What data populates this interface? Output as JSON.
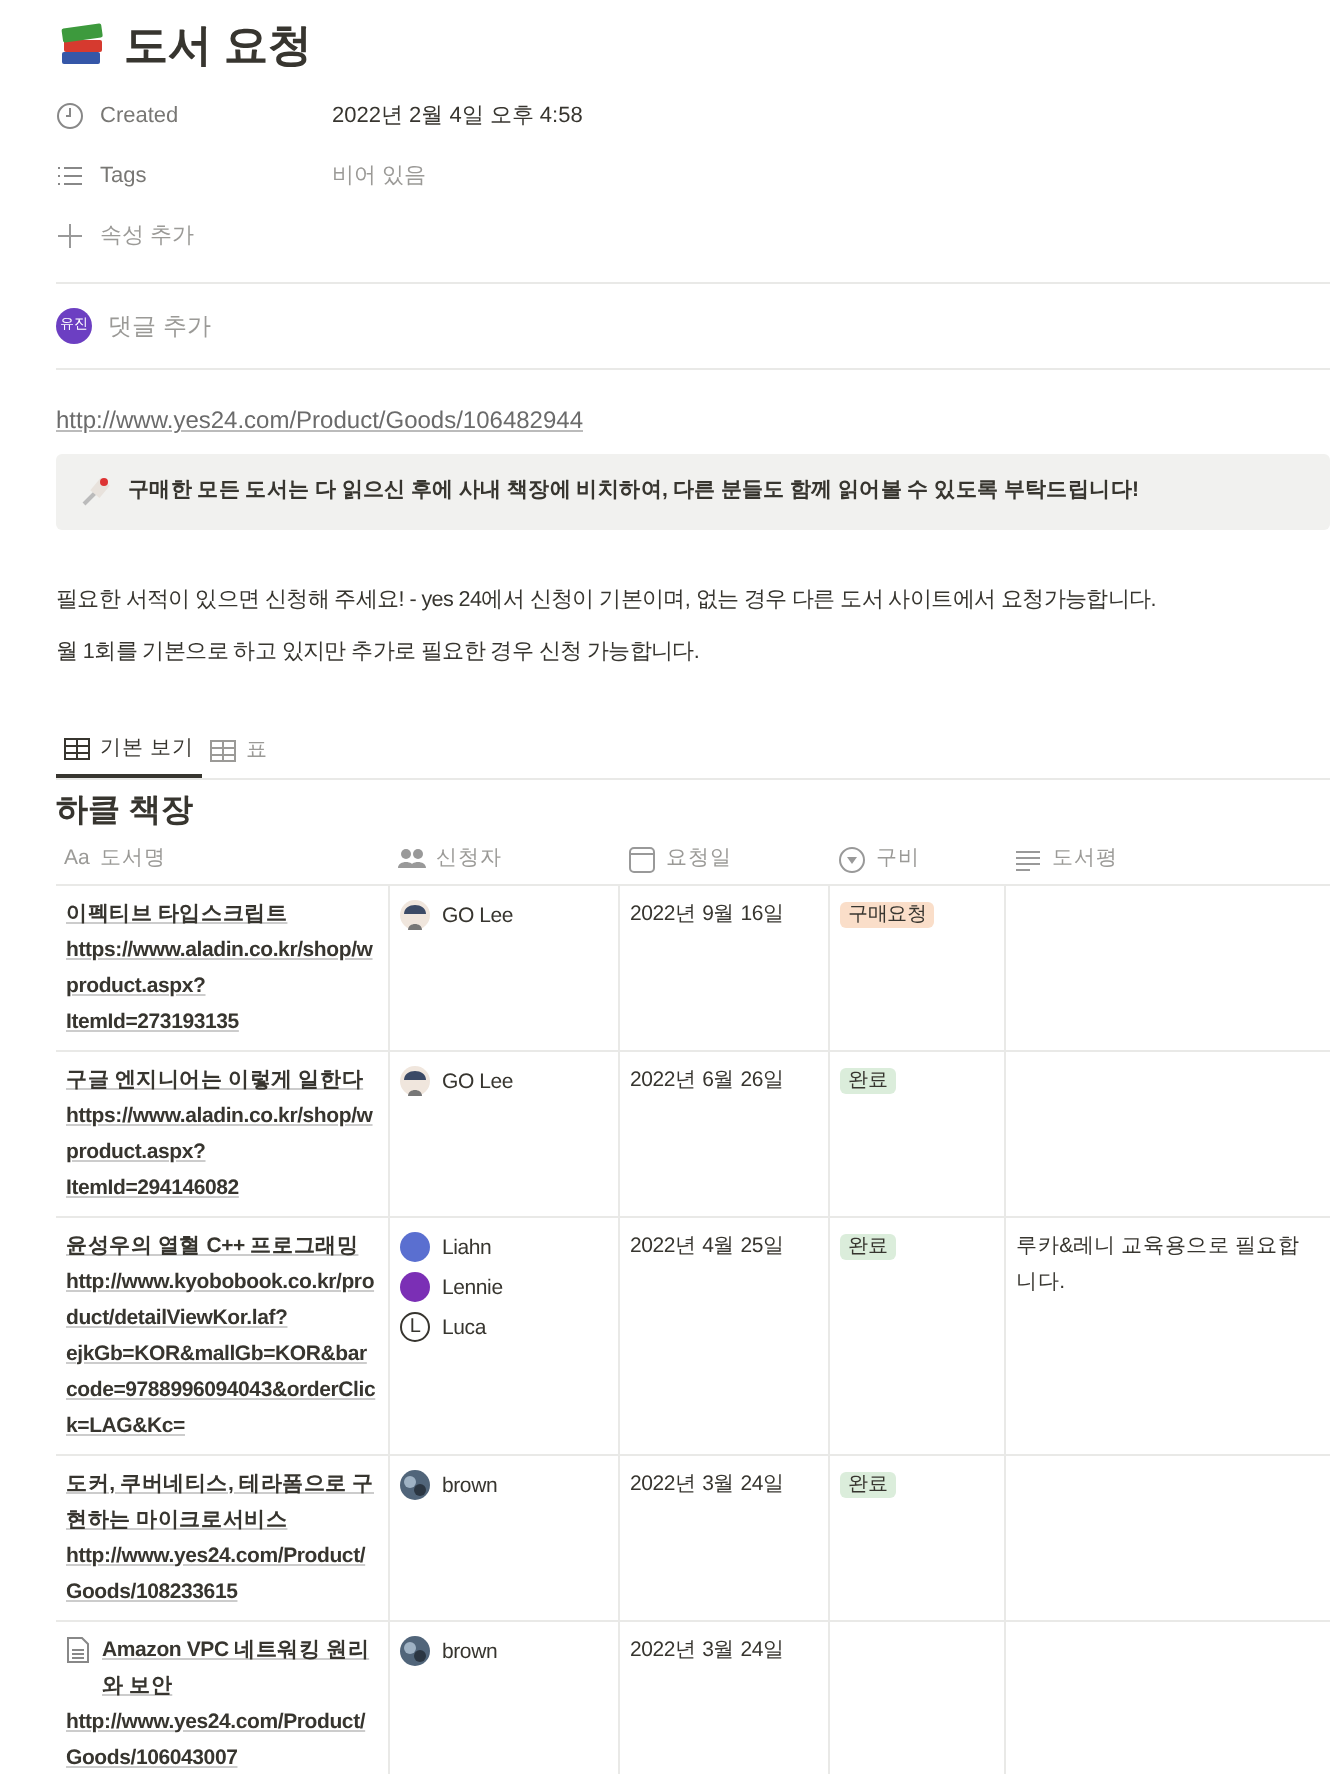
{
  "page": {
    "title": "도서 요청"
  },
  "properties": [
    {
      "kind": "date",
      "label": "Created",
      "value": "2022년 2월 4일 오후 4:58"
    },
    {
      "kind": "tags",
      "label": "Tags",
      "placeholder": "비어 있음"
    }
  ],
  "add_property": "속성 추가",
  "comment": {
    "avatar": "유진",
    "placeholder": "댓글 추가"
  },
  "link": "http://www.yes24.com/Product/Goods/106482944",
  "callout": "구매한 모든 도서는 다 읽으신 후에 사내 책장에 비치하여, 다른 분들도 함께 읽어볼 수 있도록 부탁드립니다!",
  "paragraphs": [
    "필요한 서적이 있으면 신청해 주세요! - yes 24에서 신청이 기본이며, 없는 경우 다른 도서 사이트에서 요청가능합니다.",
    "월 1회를 기본으로 하고 있지만 추가로 필요한 경우 신청 가능합니다."
  ],
  "views": [
    {
      "label": "기본 보기",
      "selected": true
    },
    {
      "label": "표",
      "selected": false
    }
  ],
  "database": {
    "title": "하클 책장",
    "columns": [
      {
        "kind": "title",
        "icon_text": "Aa",
        "label": "도서명"
      },
      {
        "kind": "person",
        "label": "신청자"
      },
      {
        "kind": "date",
        "label": "요청일"
      },
      {
        "kind": "select",
        "label": "구비"
      },
      {
        "kind": "text",
        "label": "도서평"
      }
    ],
    "rows": [
      {
        "title": "이펙티브 타입스크립트",
        "url": "https://www.aladin.co.kr/shop/wproduct.aspx?ItemId=273193135",
        "people": [
          {
            "name": "GO Lee",
            "kind": "figure"
          }
        ],
        "date": "2022년 9월 16일",
        "status": {
          "label": "구매요청",
          "color": "#fadec9"
        }
      },
      {
        "title": "구글 엔지니어는 이렇게 일한다",
        "url": "https://www.aladin.co.kr/shop/wproduct.aspx?ItemId=294146082",
        "people": [
          {
            "name": "GO Lee",
            "kind": "figure"
          }
        ],
        "date": "2022년 6월 26일",
        "status": {
          "label": "완료",
          "color": "#dbeddb"
        }
      },
      {
        "title": "윤성우의 열혈 C++ 프로그래밍",
        "url": "http://www.kyobobook.co.kr/product/detailViewKor.laf?ejkGb=KOR&mallGb=KOR&barcode=9788996094043&orderClick=LAG&Kc=",
        "people": [
          {
            "name": "Liahn",
            "kind": "solid",
            "color": "#5a6fd0"
          },
          {
            "name": "Lennie",
            "kind": "solid",
            "color": "#7b2fb5"
          },
          {
            "name": "Luca",
            "kind": "initial",
            "initial": "L",
            "color": "#37352f"
          }
        ],
        "date": "2022년 4월 25일",
        "status": {
          "label": "완료",
          "color": "#dbeddb"
        },
        "review": "루카&레니 교육용으로 필요합니다."
      },
      {
        "title": "도커, 쿠버네티스, 테라폼으로 구현하는 마이크로서비스",
        "url": "http://www.yes24.com/Product/Goods/108233615",
        "people": [
          {
            "name": "brown",
            "kind": "photo"
          }
        ],
        "date": "2022년 3월 24일",
        "status": {
          "label": "완료",
          "color": "#dbeddb"
        }
      },
      {
        "page_icon": true,
        "title": "Amazon VPC 네트워킹 원리와 보안",
        "url": "http://www.yes24.com/Product/Goods/106043007",
        "people": [
          {
            "name": "brown",
            "kind": "photo"
          }
        ],
        "date": "2022년 3월 24일"
      }
    ]
  }
}
